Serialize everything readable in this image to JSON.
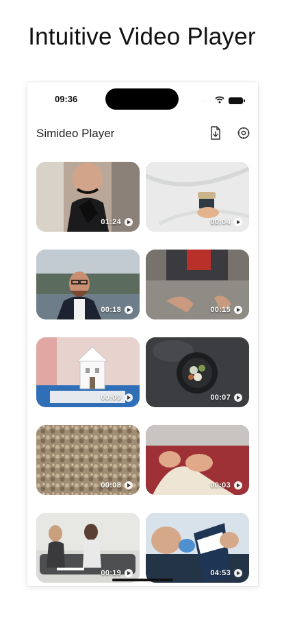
{
  "headline": "Intuitive Video Player",
  "status": {
    "time": "09:36",
    "signal": "···"
  },
  "header": {
    "title": "Simideo Player",
    "import_icon": "file-import-icon",
    "settings_icon": "settings-gear-icon"
  },
  "videos": [
    {
      "duration": "01:24",
      "scene": "woman-glove"
    },
    {
      "duration": "00:04",
      "scene": "jar-marble"
    },
    {
      "duration": "00:18",
      "scene": "man-glasses"
    },
    {
      "duration": "00:15",
      "scene": "hands-water"
    },
    {
      "duration": "00:09",
      "scene": "birdhouse"
    },
    {
      "duration": "00:07",
      "scene": "food-bowl"
    },
    {
      "duration": "00:08",
      "scene": "texture"
    },
    {
      "duration": "00:03",
      "scene": "hands-fabric"
    },
    {
      "duration": "00:19",
      "scene": "two-women-couch"
    },
    {
      "duration": "04:53",
      "scene": "hands-cards"
    }
  ],
  "colors": {
    "accent": "#000000",
    "background": "#ffffff",
    "status_inactive": "#bdbdbd"
  }
}
